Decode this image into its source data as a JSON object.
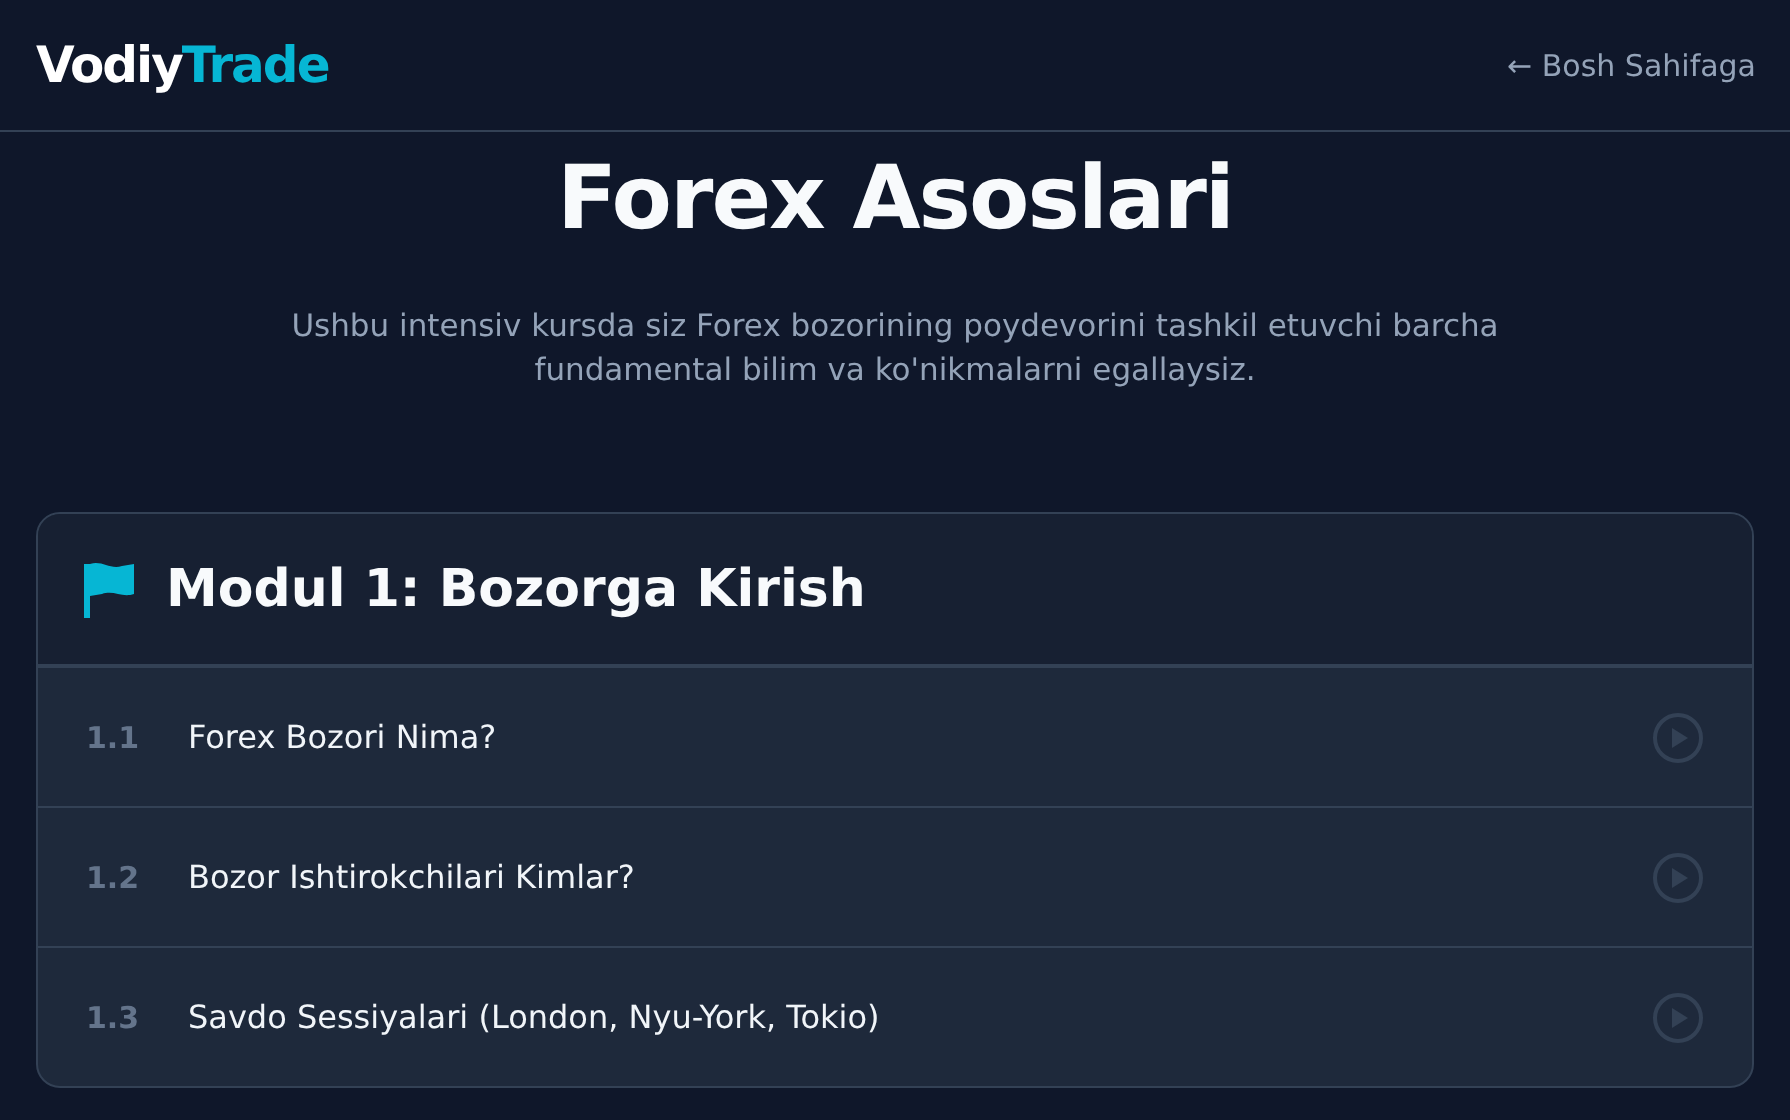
{
  "header": {
    "logo": {
      "first": "Vodiy",
      "second": "Trade"
    },
    "back_link": "← Bosh Sahifaga"
  },
  "hero": {
    "title": "Forex Asoslari",
    "subtitle": "Ushbu intensiv kursda siz Forex bozorining poydevorini tashkil etuvchi barcha fundamental bilim va ko'nikmalarni egallaysiz."
  },
  "module": {
    "title": "Modul 1: Bozorga Kirish",
    "lessons": [
      {
        "number": "1.1",
        "title": "Forex Bozori Nima?"
      },
      {
        "number": "1.2",
        "title": "Bozor Ishtirokchilari Kimlar?"
      },
      {
        "number": "1.3",
        "title": "Savdo Sessiyalari (London, Nyu-York, Tokio)"
      }
    ]
  }
}
